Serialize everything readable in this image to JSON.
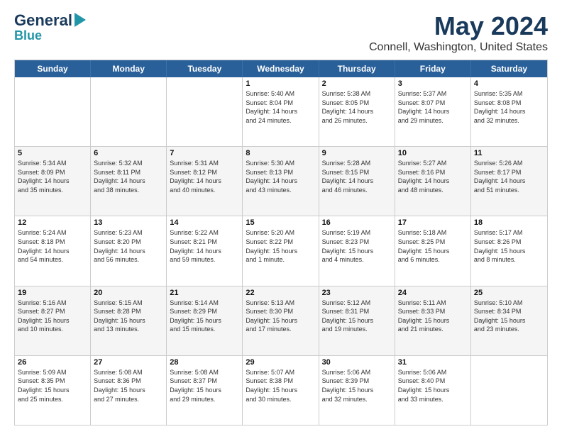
{
  "logo": {
    "general": "General",
    "blue": "Blue",
    "arrow": "▶"
  },
  "title": "May 2024",
  "subtitle": "Connell, Washington, United States",
  "weekdays": [
    "Sunday",
    "Monday",
    "Tuesday",
    "Wednesday",
    "Thursday",
    "Friday",
    "Saturday"
  ],
  "weeks": [
    {
      "alt": false,
      "days": [
        {
          "num": "",
          "lines": []
        },
        {
          "num": "",
          "lines": []
        },
        {
          "num": "",
          "lines": []
        },
        {
          "num": "1",
          "lines": [
            "Sunrise: 5:40 AM",
            "Sunset: 8:04 PM",
            "Daylight: 14 hours",
            "and 24 minutes."
          ]
        },
        {
          "num": "2",
          "lines": [
            "Sunrise: 5:38 AM",
            "Sunset: 8:05 PM",
            "Daylight: 14 hours",
            "and 26 minutes."
          ]
        },
        {
          "num": "3",
          "lines": [
            "Sunrise: 5:37 AM",
            "Sunset: 8:07 PM",
            "Daylight: 14 hours",
            "and 29 minutes."
          ]
        },
        {
          "num": "4",
          "lines": [
            "Sunrise: 5:35 AM",
            "Sunset: 8:08 PM",
            "Daylight: 14 hours",
            "and 32 minutes."
          ]
        }
      ]
    },
    {
      "alt": true,
      "days": [
        {
          "num": "5",
          "lines": [
            "Sunrise: 5:34 AM",
            "Sunset: 8:09 PM",
            "Daylight: 14 hours",
            "and 35 minutes."
          ]
        },
        {
          "num": "6",
          "lines": [
            "Sunrise: 5:32 AM",
            "Sunset: 8:11 PM",
            "Daylight: 14 hours",
            "and 38 minutes."
          ]
        },
        {
          "num": "7",
          "lines": [
            "Sunrise: 5:31 AM",
            "Sunset: 8:12 PM",
            "Daylight: 14 hours",
            "and 40 minutes."
          ]
        },
        {
          "num": "8",
          "lines": [
            "Sunrise: 5:30 AM",
            "Sunset: 8:13 PM",
            "Daylight: 14 hours",
            "and 43 minutes."
          ]
        },
        {
          "num": "9",
          "lines": [
            "Sunrise: 5:28 AM",
            "Sunset: 8:15 PM",
            "Daylight: 14 hours",
            "and 46 minutes."
          ]
        },
        {
          "num": "10",
          "lines": [
            "Sunrise: 5:27 AM",
            "Sunset: 8:16 PM",
            "Daylight: 14 hours",
            "and 48 minutes."
          ]
        },
        {
          "num": "11",
          "lines": [
            "Sunrise: 5:26 AM",
            "Sunset: 8:17 PM",
            "Daylight: 14 hours",
            "and 51 minutes."
          ]
        }
      ]
    },
    {
      "alt": false,
      "days": [
        {
          "num": "12",
          "lines": [
            "Sunrise: 5:24 AM",
            "Sunset: 8:18 PM",
            "Daylight: 14 hours",
            "and 54 minutes."
          ]
        },
        {
          "num": "13",
          "lines": [
            "Sunrise: 5:23 AM",
            "Sunset: 8:20 PM",
            "Daylight: 14 hours",
            "and 56 minutes."
          ]
        },
        {
          "num": "14",
          "lines": [
            "Sunrise: 5:22 AM",
            "Sunset: 8:21 PM",
            "Daylight: 14 hours",
            "and 59 minutes."
          ]
        },
        {
          "num": "15",
          "lines": [
            "Sunrise: 5:20 AM",
            "Sunset: 8:22 PM",
            "Daylight: 15 hours",
            "and 1 minute."
          ]
        },
        {
          "num": "16",
          "lines": [
            "Sunrise: 5:19 AM",
            "Sunset: 8:23 PM",
            "Daylight: 15 hours",
            "and 4 minutes."
          ]
        },
        {
          "num": "17",
          "lines": [
            "Sunrise: 5:18 AM",
            "Sunset: 8:25 PM",
            "Daylight: 15 hours",
            "and 6 minutes."
          ]
        },
        {
          "num": "18",
          "lines": [
            "Sunrise: 5:17 AM",
            "Sunset: 8:26 PM",
            "Daylight: 15 hours",
            "and 8 minutes."
          ]
        }
      ]
    },
    {
      "alt": true,
      "days": [
        {
          "num": "19",
          "lines": [
            "Sunrise: 5:16 AM",
            "Sunset: 8:27 PM",
            "Daylight: 15 hours",
            "and 10 minutes."
          ]
        },
        {
          "num": "20",
          "lines": [
            "Sunrise: 5:15 AM",
            "Sunset: 8:28 PM",
            "Daylight: 15 hours",
            "and 13 minutes."
          ]
        },
        {
          "num": "21",
          "lines": [
            "Sunrise: 5:14 AM",
            "Sunset: 8:29 PM",
            "Daylight: 15 hours",
            "and 15 minutes."
          ]
        },
        {
          "num": "22",
          "lines": [
            "Sunrise: 5:13 AM",
            "Sunset: 8:30 PM",
            "Daylight: 15 hours",
            "and 17 minutes."
          ]
        },
        {
          "num": "23",
          "lines": [
            "Sunrise: 5:12 AM",
            "Sunset: 8:31 PM",
            "Daylight: 15 hours",
            "and 19 minutes."
          ]
        },
        {
          "num": "24",
          "lines": [
            "Sunrise: 5:11 AM",
            "Sunset: 8:33 PM",
            "Daylight: 15 hours",
            "and 21 minutes."
          ]
        },
        {
          "num": "25",
          "lines": [
            "Sunrise: 5:10 AM",
            "Sunset: 8:34 PM",
            "Daylight: 15 hours",
            "and 23 minutes."
          ]
        }
      ]
    },
    {
      "alt": false,
      "days": [
        {
          "num": "26",
          "lines": [
            "Sunrise: 5:09 AM",
            "Sunset: 8:35 PM",
            "Daylight: 15 hours",
            "and 25 minutes."
          ]
        },
        {
          "num": "27",
          "lines": [
            "Sunrise: 5:08 AM",
            "Sunset: 8:36 PM",
            "Daylight: 15 hours",
            "and 27 minutes."
          ]
        },
        {
          "num": "28",
          "lines": [
            "Sunrise: 5:08 AM",
            "Sunset: 8:37 PM",
            "Daylight: 15 hours",
            "and 29 minutes."
          ]
        },
        {
          "num": "29",
          "lines": [
            "Sunrise: 5:07 AM",
            "Sunset: 8:38 PM",
            "Daylight: 15 hours",
            "and 30 minutes."
          ]
        },
        {
          "num": "30",
          "lines": [
            "Sunrise: 5:06 AM",
            "Sunset: 8:39 PM",
            "Daylight: 15 hours",
            "and 32 minutes."
          ]
        },
        {
          "num": "31",
          "lines": [
            "Sunrise: 5:06 AM",
            "Sunset: 8:40 PM",
            "Daylight: 15 hours",
            "and 33 minutes."
          ]
        },
        {
          "num": "",
          "lines": []
        }
      ]
    }
  ]
}
